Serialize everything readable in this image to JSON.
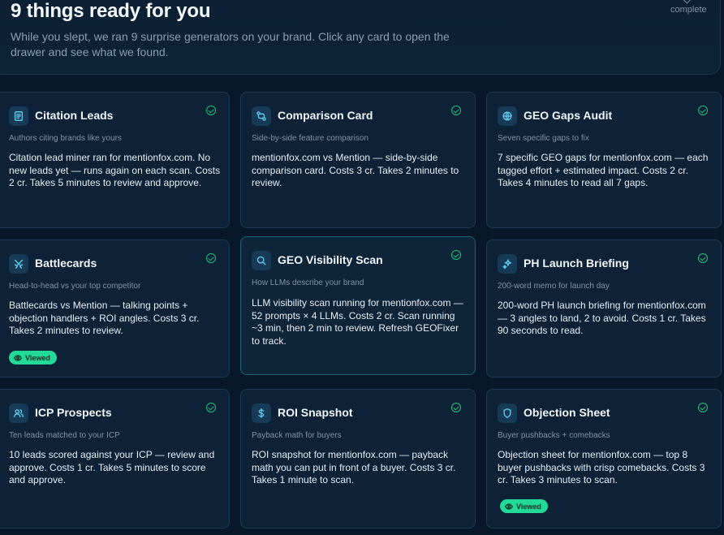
{
  "hero": {
    "title": "9 things ready for you",
    "subtitle": "While you slept, we ran 9 surprise generators on your brand. Click any card to open the drawer and see what we found.",
    "complete_label": "complete"
  },
  "viewed_label": "Viewed",
  "cards": [
    {
      "title": "Citation Leads",
      "subtitle": "Authors citing brands like yours",
      "body": "Citation lead miner ran for mentionfox.com. No new leads yet — runs again on each scan. Costs 2 cr. Takes 5 minutes to review and approve.",
      "icon": "document-icon",
      "viewed": false
    },
    {
      "title": "Comparison Card",
      "subtitle": "Side-by-side feature comparison",
      "body": "mentionfox.com vs Mention — side-by-side comparison card. Costs 3 cr. Takes 2 minutes to review.",
      "icon": "compare-arrows-icon",
      "viewed": false
    },
    {
      "title": "GEO Gaps Audit",
      "subtitle": "Seven specific gaps to fix",
      "body": "7 specific GEO gaps for mentionfox.com — each tagged effort + estimated impact. Costs 2 cr. Takes 4 minutes to read all 7 gaps.",
      "icon": "globe-icon",
      "viewed": false
    },
    {
      "title": "Battlecards",
      "subtitle": "Head-to-head vs your top competitor",
      "body": "Battlecards vs Mention — talking points + objection handlers + ROI angles. Costs 3 cr. Takes 2 minutes to review.",
      "icon": "swords-icon",
      "viewed": true
    },
    {
      "title": "GEO Visibility Scan",
      "subtitle": "How LLMs describe your brand",
      "body": "LLM visibility scan running for mentionfox.com — 52 prompts × 4 LLMs. Costs 2 cr. Scan running ~3 min, then 2 min to review. Refresh GEOFixer to track.",
      "icon": "search-icon",
      "viewed": false
    },
    {
      "title": "PH Launch Briefing",
      "subtitle": "200-word memo for launch day",
      "body": "200-word PH launch briefing for mentionfox.com — 3 angles to land, 2 to avoid. Costs 1 cr. Takes 90 seconds to read.",
      "icon": "sparkle-icon",
      "viewed": false
    },
    {
      "title": "ICP Prospects",
      "subtitle": "Ten leads matched to your ICP",
      "body": "10 leads scored against your ICP — review and approve. Costs 1 cr. Takes 5 minutes to score and approve.",
      "icon": "users-icon",
      "viewed": false
    },
    {
      "title": "ROI Snapshot",
      "subtitle": "Payback math for buyers",
      "body": "ROI snapshot for mentionfox.com — payback math you can put in front of a buyer. Costs 3 cr. Takes 1 minute to scan.",
      "icon": "dollar-icon",
      "viewed": false
    },
    {
      "title": "Objection Sheet",
      "subtitle": "Buyer pushbacks + comebacks",
      "body": "Objection sheet for mentionfox.com — top 8 buyer pushbacks with crisp comebacks. Costs 3 cr. Takes 3 minutes to scan.",
      "icon": "shield-icon",
      "viewed": true
    }
  ]
}
